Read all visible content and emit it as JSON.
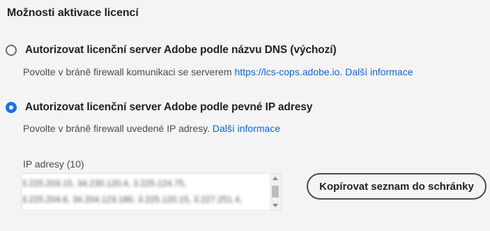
{
  "section_title": "Možnosti aktivace licencí",
  "options": [
    {
      "label": "Autorizovat licenční server Adobe podle názvu DNS (výchozí)",
      "selected": false,
      "description": "Povolte v bráně firewall komunikaci se serverem ",
      "url_link": "https://lcs-cops.adobe.io.",
      "more_link": "Další informace"
    },
    {
      "label": "Autorizovat licenční server Adobe podle pevné IP adresy",
      "selected": true,
      "description": "Povolte v bráně firewall uvedené IP adresy. ",
      "more_link": "Další informace"
    }
  ],
  "ip_addresses": {
    "label": "IP adresy (10)",
    "lines": [
      "3.225.203.15, 34.230.120.4, 3.225.124.75,",
      "3.225.204.6, 34.204.123.180, 3.225.120.15, 3.227.251.4,"
    ],
    "blurred": true
  },
  "copy_button": {
    "label": "Kopírovat seznam do schránky"
  },
  "colors": {
    "accent": "#1473e6",
    "link": "#0d66d0",
    "background": "#f4f4f4"
  }
}
